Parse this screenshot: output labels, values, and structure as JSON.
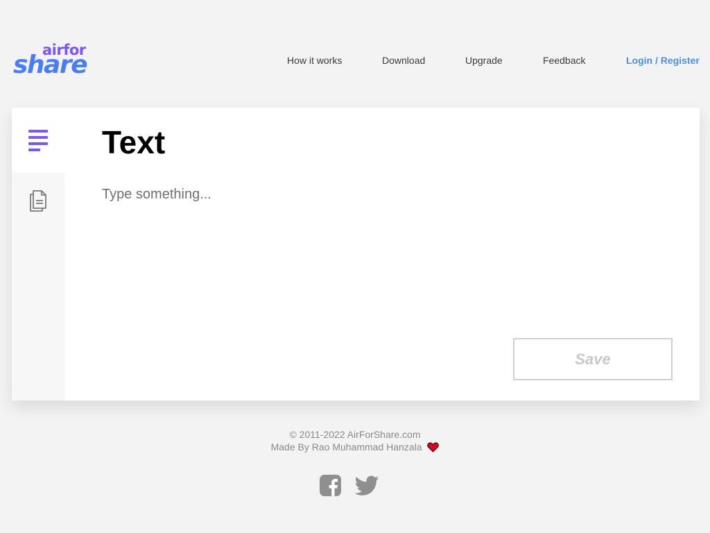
{
  "header": {
    "logo": {
      "line1": "airfor",
      "line2": "share"
    },
    "nav": {
      "how_it_works": "How it works",
      "download": "Download",
      "upgrade": "Upgrade",
      "feedback": "Feedback",
      "login": "Login",
      "separator": " / ",
      "register": "Register"
    }
  },
  "sidebar": {
    "tabs": [
      {
        "icon": "text-lines-icon",
        "active": true
      },
      {
        "icon": "files-icon",
        "active": false
      }
    ]
  },
  "main": {
    "title": "Text",
    "textarea": {
      "value": "",
      "placeholder": "Type something..."
    },
    "save_label": "Save"
  },
  "footer": {
    "copyright": "© 2011-2022 AirForShare.com",
    "made_by": "Made By Rao Muhammad Hanzala",
    "heart_icon": "heart-icon",
    "social": [
      "facebook-icon",
      "twitter-icon"
    ]
  },
  "colors": {
    "background": "#f3f3f3",
    "brand_purple": "#7c56f2",
    "brand_blue": "#4a7cf6",
    "link_blue": "#4a90e2",
    "heart_red": "#e0001a",
    "social_gray": "#8f8f8f"
  }
}
